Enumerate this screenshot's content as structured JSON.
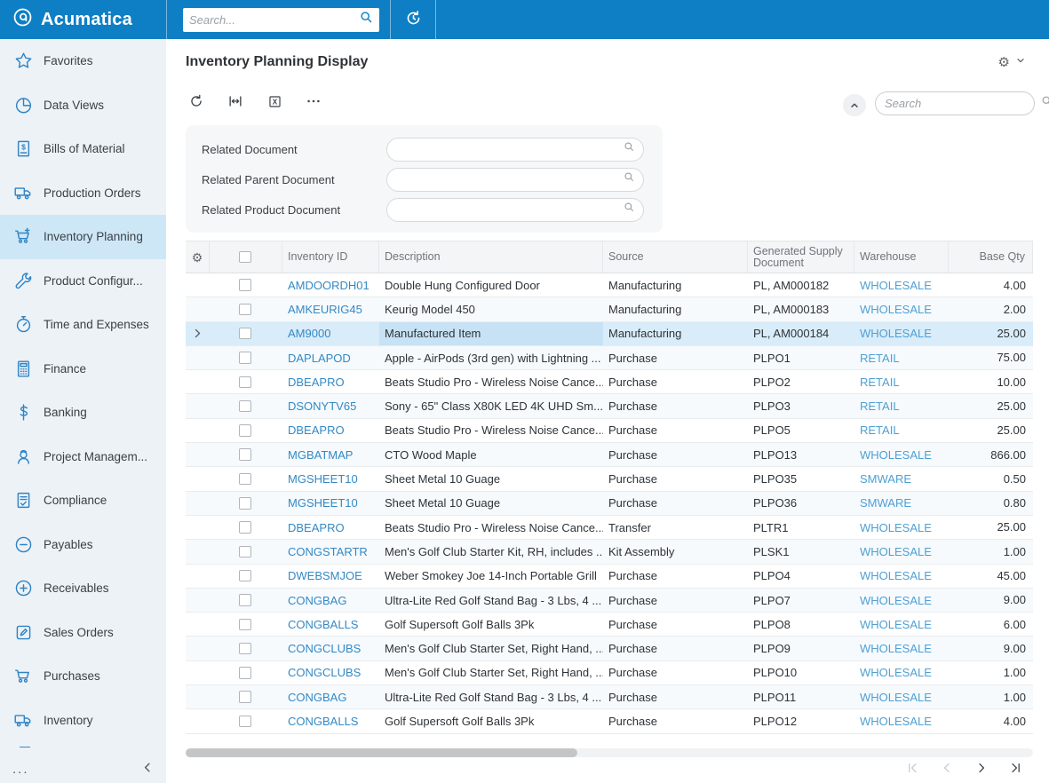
{
  "topbar": {
    "brand": "Acumatica",
    "search_placeholder": "Search...",
    "icons": [
      "acumatica-logo",
      "search",
      "business-date"
    ]
  },
  "sidebar": {
    "items": [
      {
        "label": "Favorites",
        "icon": "star"
      },
      {
        "label": "Data Views",
        "icon": "pie-chart"
      },
      {
        "label": "Bills of Material",
        "icon": "bill-dollar"
      },
      {
        "label": "Production Orders",
        "icon": "delivery-truck"
      },
      {
        "label": "Inventory Planning",
        "icon": "cart-plus",
        "selected": true
      },
      {
        "label": "Product Configur...",
        "icon": "wrench"
      },
      {
        "label": "Time and Expenses",
        "icon": "stopwatch"
      },
      {
        "label": "Finance",
        "icon": "calculator"
      },
      {
        "label": "Banking",
        "icon": "dollar"
      },
      {
        "label": "Project Managem...",
        "icon": "worker"
      },
      {
        "label": "Compliance",
        "icon": "document-check"
      },
      {
        "label": "Payables",
        "icon": "minus-circle"
      },
      {
        "label": "Receivables",
        "icon": "plus-circle"
      },
      {
        "label": "Sales Orders",
        "icon": "pencil-square"
      },
      {
        "label": "Purchases",
        "icon": "cart"
      },
      {
        "label": "Inventory",
        "icon": "delivery-truck"
      }
    ],
    "more_label": "...",
    "collapse_icon": "chevron-left"
  },
  "page": {
    "title": "Inventory Planning Display"
  },
  "toolbar": {
    "icons": [
      "refresh",
      "fit-width",
      "export-excel",
      "ellipsis"
    ]
  },
  "panel": {
    "search_placeholder": "Search"
  },
  "filters": {
    "rows": [
      {
        "label": "Related Document"
      },
      {
        "label": "Related Parent Document"
      },
      {
        "label": "Related Product Document"
      }
    ]
  },
  "table": {
    "columns": [
      "Inventory ID",
      "Description",
      "Source",
      "Generated Supply Document",
      "Warehouse",
      "Base Qty"
    ],
    "selected_row_index": 2,
    "rows": [
      {
        "inventory_id": "AMDOORDH01",
        "description": "Double Hung Configured Door",
        "source": "Manufacturing",
        "supply_document": "PL, AM000182",
        "warehouse": "WHOLESALE",
        "base_qty": "4.00"
      },
      {
        "inventory_id": "AMKEURIG45",
        "description": "Keurig Model 450",
        "source": "Manufacturing",
        "supply_document": "PL, AM000183",
        "warehouse": "WHOLESALE",
        "base_qty": "2.00"
      },
      {
        "inventory_id": "AM9000",
        "description": "Manufactured Item",
        "source": "Manufacturing",
        "supply_document": "PL, AM000184",
        "warehouse": "WHOLESALE",
        "base_qty": "25.00"
      },
      {
        "inventory_id": "DAPLAPOD",
        "description": "Apple - AirPods (3rd gen) with Lightning ...",
        "source": "Purchase",
        "supply_document": "PLPO1",
        "warehouse": "RETAIL",
        "base_qty": "75.00"
      },
      {
        "inventory_id": "DBEAPRO",
        "description": "Beats Studio Pro - Wireless Noise Cance...",
        "source": "Purchase",
        "supply_document": "PLPO2",
        "warehouse": "RETAIL",
        "base_qty": "10.00"
      },
      {
        "inventory_id": "DSONYTV65",
        "description": "Sony - 65\" Class X80K LED 4K UHD Sm...",
        "source": "Purchase",
        "supply_document": "PLPO3",
        "warehouse": "RETAIL",
        "base_qty": "25.00"
      },
      {
        "inventory_id": "DBEAPRO",
        "description": "Beats Studio Pro - Wireless Noise Cance...",
        "source": "Purchase",
        "supply_document": "PLPO5",
        "warehouse": "RETAIL",
        "base_qty": "25.00"
      },
      {
        "inventory_id": "MGBATMAP",
        "description": "CTO Wood Maple",
        "source": "Purchase",
        "supply_document": "PLPO13",
        "warehouse": "WHOLESALE",
        "base_qty": "866.00"
      },
      {
        "inventory_id": "MGSHEET10",
        "description": "Sheet Metal 10 Guage",
        "source": "Purchase",
        "supply_document": "PLPO35",
        "warehouse": "SMWARE",
        "base_qty": "0.50"
      },
      {
        "inventory_id": "MGSHEET10",
        "description": "Sheet Metal 10 Guage",
        "source": "Purchase",
        "supply_document": "PLPO36",
        "warehouse": "SMWARE",
        "base_qty": "0.80"
      },
      {
        "inventory_id": "DBEAPRO",
        "description": "Beats Studio Pro - Wireless Noise Cance...",
        "source": "Transfer",
        "supply_document": "PLTR1",
        "warehouse": "WHOLESALE",
        "base_qty": "25.00"
      },
      {
        "inventory_id": "CONGSTARTR",
        "description": "Men's Golf Club Starter Kit, RH, includes ...",
        "source": "Kit Assembly",
        "supply_document": "PLSK1",
        "warehouse": "WHOLESALE",
        "base_qty": "1.00"
      },
      {
        "inventory_id": "DWEBSMJOE",
        "description": "Weber Smokey Joe 14-Inch Portable Grill",
        "source": "Purchase",
        "supply_document": "PLPO4",
        "warehouse": "WHOLESALE",
        "base_qty": "45.00"
      },
      {
        "inventory_id": "CONGBAG",
        "description": "Ultra-Lite Red Golf Stand Bag - 3 Lbs, 4 ...",
        "source": "Purchase",
        "supply_document": "PLPO7",
        "warehouse": "WHOLESALE",
        "base_qty": "9.00"
      },
      {
        "inventory_id": "CONGBALLS",
        "description": "Golf Supersoft Golf Balls 3Pk",
        "source": "Purchase",
        "supply_document": "PLPO8",
        "warehouse": "WHOLESALE",
        "base_qty": "6.00"
      },
      {
        "inventory_id": "CONGCLUBS",
        "description": "Men's Golf Club Starter Set, Right Hand, ...",
        "source": "Purchase",
        "supply_document": "PLPO9",
        "warehouse": "WHOLESALE",
        "base_qty": "9.00"
      },
      {
        "inventory_id": "CONGCLUBS",
        "description": "Men's Golf Club Starter Set, Right Hand, ...",
        "source": "Purchase",
        "supply_document": "PLPO10",
        "warehouse": "WHOLESALE",
        "base_qty": "1.00"
      },
      {
        "inventory_id": "CONGBAG",
        "description": "Ultra-Lite Red Golf Stand Bag - 3 Lbs, 4 ...",
        "source": "Purchase",
        "supply_document": "PLPO11",
        "warehouse": "WHOLESALE",
        "base_qty": "1.00"
      },
      {
        "inventory_id": "CONGBALLS",
        "description": "Golf Supersoft Golf Balls 3Pk",
        "source": "Purchase",
        "supply_document": "PLPO12",
        "warehouse": "WHOLESALE",
        "base_qty": "4.00"
      }
    ]
  },
  "pagination": {
    "icons": [
      "first-page",
      "previous-page",
      "next-page",
      "last-page"
    ]
  },
  "colors": {
    "topbar_bg": "#0e7fc4",
    "sidebar_bg": "#edf2f7",
    "sidebar_selected_bg": "#cde7f7",
    "sidebar_icon_blue": "#3084c4",
    "inventory_link_blue": "#3389c5",
    "warehouse_link_blue": "#4ea0d3",
    "selected_row_bg": "#d9ecf9",
    "active_cell_bg": "#c6e2f4"
  }
}
